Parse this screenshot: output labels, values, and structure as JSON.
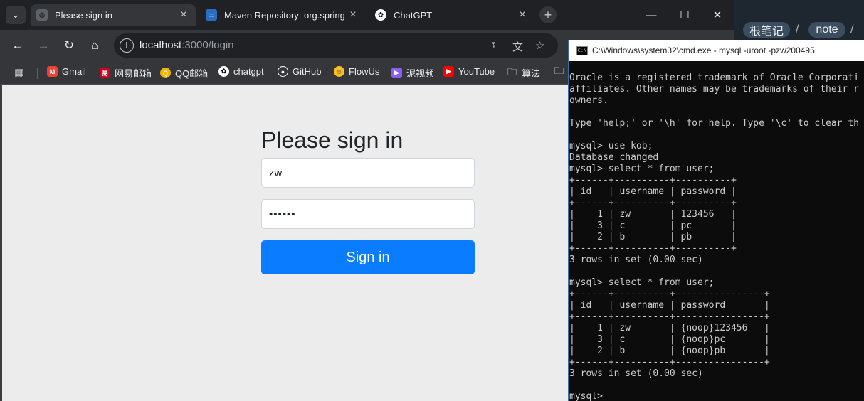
{
  "browser": {
    "tabs": [
      {
        "title": "Please sign in",
        "active": true
      },
      {
        "title": "Maven Repository: org.spring",
        "active": false
      },
      {
        "title": "ChatGPT",
        "active": false
      }
    ],
    "url_host": "localhost",
    "url_path": ":3000/login",
    "bookmarks": [
      {
        "label": "Gmail",
        "icon": "gmail-icon",
        "color": "#ea4335"
      },
      {
        "label": "网易邮箱",
        "icon": "netease-mail-icon",
        "color": "#d0021b"
      },
      {
        "label": "QQ邮箱",
        "icon": "qq-mail-icon",
        "color": "#f4b400"
      },
      {
        "label": "chatgpt",
        "icon": "chatgpt-icon",
        "color": "#ffffff"
      },
      {
        "label": "GitHub",
        "icon": "github-icon",
        "color": "#ffffff"
      },
      {
        "label": "FlowUs",
        "icon": "flowus-icon",
        "color": "#fbbf24"
      },
      {
        "label": "泥视频",
        "icon": "video-icon",
        "color": "#8b5cf6"
      },
      {
        "label": "YouTube",
        "icon": "youtube-icon",
        "color": "#ff0000"
      },
      {
        "label": "算法",
        "icon": "folder-icon",
        "color": "#e8eaed"
      }
    ]
  },
  "page": {
    "heading": "Please sign in",
    "username_value": "zw",
    "password_value": "••••••",
    "submit_label": "Sign in",
    "accent_color": "#0a7cff"
  },
  "background_app": {
    "crumbs": [
      "根笔记",
      "note"
    ]
  },
  "terminal": {
    "title": "C:\\Windows\\system32\\cmd.exe - mysql  -uroot -pzw200495",
    "lines": [
      "Oracle is a registered trademark of Oracle Corporati",
      "affiliates. Other names may be trademarks of their r",
      "owners.",
      "",
      "Type 'help;' or '\\h' for help. Type '\\c' to clear th",
      "",
      "mysql> use kob;",
      "Database changed",
      "mysql> select * from user;",
      "+------+----------+----------+",
      "| id   | username | password |",
      "+------+----------+----------+",
      "|    1 | zw       | 123456   |",
      "|    3 | c        | pc       |",
      "|    2 | b        | pb       |",
      "+------+----------+----------+",
      "3 rows in set (0.00 sec)",
      "",
      "mysql> select * from user;",
      "+------+----------+----------------+",
      "| id   | username | password       |",
      "+------+----------+----------------+",
      "|    1 | zw       | {noop}123456   |",
      "|    3 | c        | {noop}pc       |",
      "|    2 | b        | {noop}pb       |",
      "+------+----------+----------------+",
      "3 rows in set (0.00 sec)",
      "",
      "mysql>"
    ]
  }
}
